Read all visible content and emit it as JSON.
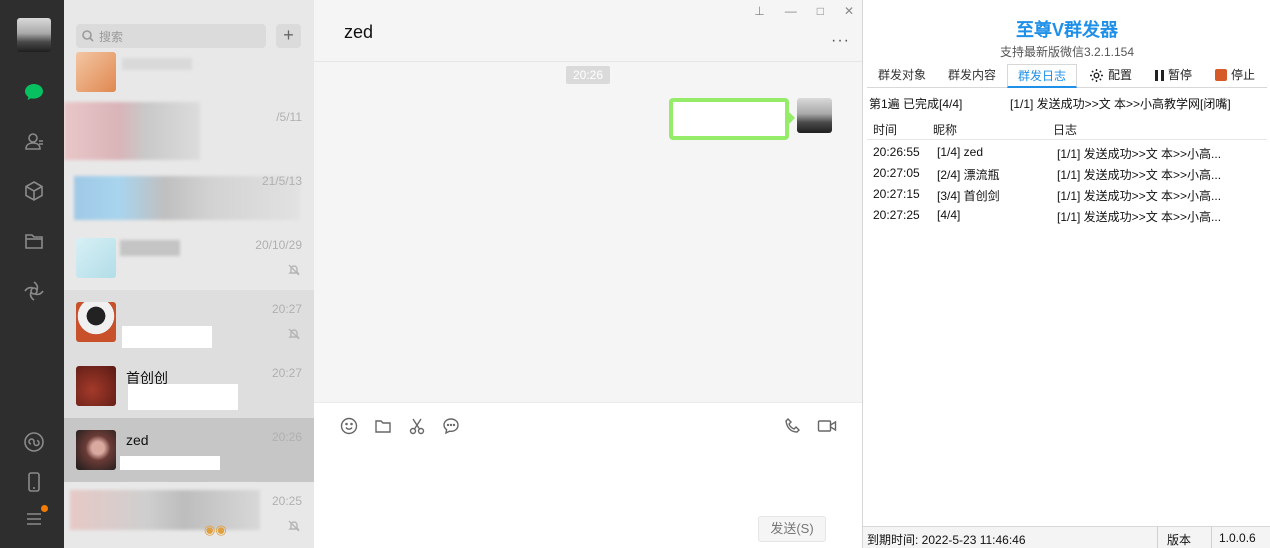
{
  "search": {
    "placeholder": "搜索"
  },
  "chats": [
    {
      "time": ""
    },
    {
      "time": "/5/11"
    },
    {
      "time": "21/5/13"
    },
    {
      "time": "20/10/29"
    },
    {
      "time": "20:27"
    },
    {
      "name": "首创创",
      "time": "20:27"
    },
    {
      "name": "zed",
      "time": "20:26"
    },
    {
      "time": "20:25"
    }
  ],
  "conversation": {
    "title": "zed",
    "time_badge": "20:26",
    "send_label": "发送(S)"
  },
  "panel": {
    "title": "至尊V群发器",
    "subtitle": "支持最新版微信3.2.1.154",
    "tabs": [
      "群发对象",
      "群发内容",
      "群发日志"
    ],
    "active_tab": 2,
    "config_label": "配置",
    "pause_label": "暂停",
    "stop_label": "停止",
    "status_left": "第1遍 已完成[4/4]",
    "status_right": "[1/1] 发送成功>>文  本>>小高教学网[闭嘴]",
    "columns": [
      "时间",
      "昵称",
      "日志"
    ],
    "rows": [
      {
        "time": "20:26:55",
        "nick": "[1/4] zed",
        "log": "[1/1] 发送成功>>文  本>>小高..."
      },
      {
        "time": "20:27:05",
        "nick": "[2/4] 漂流瓶",
        "log": "[1/1] 发送成功>>文  本>>小高..."
      },
      {
        "time": "20:27:15",
        "nick": "[3/4] 首创剑",
        "log": "[1/1] 发送成功>>文  本>>小高..."
      },
      {
        "time": "20:27:25",
        "nick": "[4/4]",
        "log": "[1/1] 发送成功>>文  本>>小高..."
      }
    ],
    "footer": {
      "expire": "到期时间: 2022-5-23 11:46:46",
      "version_label": "版本",
      "version": "1.0.0.6"
    }
  },
  "colors": {
    "accent": "#1e90e8",
    "bubble": "#95ec69",
    "stop": "#d55a28"
  }
}
